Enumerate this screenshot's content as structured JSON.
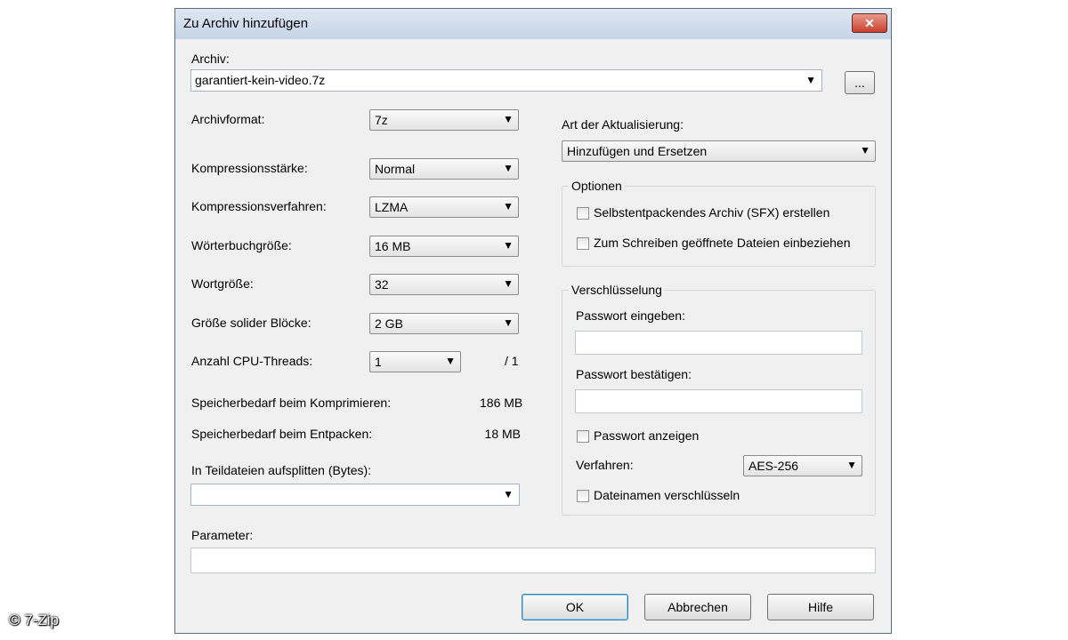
{
  "window": {
    "title": "Zu Archiv hinzufügen",
    "close_glyph": "✕"
  },
  "archive": {
    "label": "Archiv:",
    "value": "garantiert-kein-video.7z",
    "browse_label": "..."
  },
  "left": {
    "format_label": "Archivformat:",
    "format_value": "7z",
    "level_label": "Kompressionsstärke:",
    "level_value": "Normal",
    "method_label": "Kompressionsverfahren:",
    "method_value": "LZMA",
    "dict_label": "Wörterbuchgröße:",
    "dict_value": "16 MB",
    "word_label": "Wortgröße:",
    "word_value": "32",
    "solid_label": "Größe solider Blöcke:",
    "solid_value": "2 GB",
    "threads_label": "Anzahl CPU-Threads:",
    "threads_value": "1",
    "threads_max": "/ 1",
    "mem_compress_label": "Speicherbedarf beim Komprimieren:",
    "mem_compress_value": "186 MB",
    "mem_decompress_label": "Speicherbedarf beim Entpacken:",
    "mem_decompress_value": "18 MB",
    "split_label": "In Teildateien aufsplitten (Bytes):",
    "split_value": ""
  },
  "right": {
    "update_label": "Art der Aktualisierung:",
    "update_value": "Hinzufügen und Ersetzen",
    "options_title": "Optionen",
    "opt_sfx": "Selbstentpackendes Archiv (SFX) erstellen",
    "opt_shared": "Zum Schreiben geöffnete Dateien einbeziehen",
    "enc_title": "Verschlüsselung",
    "pwd_label": "Passwort eingeben:",
    "pwd_value": "",
    "pwd_confirm_label": "Passwort bestätigen:",
    "pwd_confirm_value": "",
    "show_pwd": "Passwort anzeigen",
    "method_label": "Verfahren:",
    "method_value": "AES-256",
    "encrypt_names": "Dateinamen verschlüsseln"
  },
  "params": {
    "label": "Parameter:",
    "value": ""
  },
  "buttons": {
    "ok": "OK",
    "cancel": "Abbrechen",
    "help": "Hilfe"
  },
  "arrow_glyph": "▼",
  "watermark": "© 7-Zip"
}
